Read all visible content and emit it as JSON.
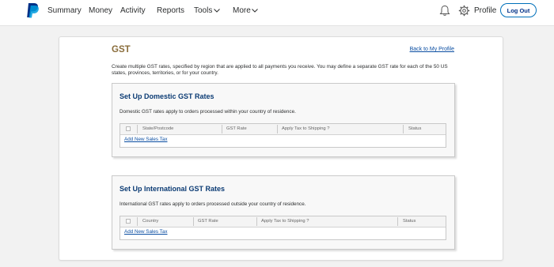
{
  "nav": {
    "logo": "paypal-logo-icon",
    "items": [
      "Summary",
      "Money",
      "Activity",
      "Reports",
      "Tools",
      "More"
    ],
    "profile_label": "Profile",
    "logout_label": "Log Out"
  },
  "page": {
    "title": "GST",
    "back_link": "Back to My Profile",
    "intro": "Create multiple GST rates, specified by region that are applied to all payments you receive. You may define a separate GST rate for each of the 50 US states, provinces, territories, or for your country."
  },
  "domestic": {
    "title": "Set Up Domestic GST Rates",
    "description": "Domestic GST rates apply to orders processed within your country of residence.",
    "columns": [
      "State/Postcode",
      "GST Rate",
      "Apply Tax to Shipping ?",
      "Status"
    ],
    "add_link": "Add New Sales Tax"
  },
  "international": {
    "title": "Set Up International GST Rates",
    "description": "International GST rates apply to orders processed outside your country of residence.",
    "columns": [
      "Country",
      "GST Rate",
      "Apply Tax to Shipping ?",
      "Status"
    ],
    "add_link": "Add New Sales Tax"
  },
  "colors": {
    "accent_blue": "#0070ba",
    "title_brown": "#8a6d3b",
    "section_title": "#0b3b74",
    "link": "#0b4ea2"
  }
}
